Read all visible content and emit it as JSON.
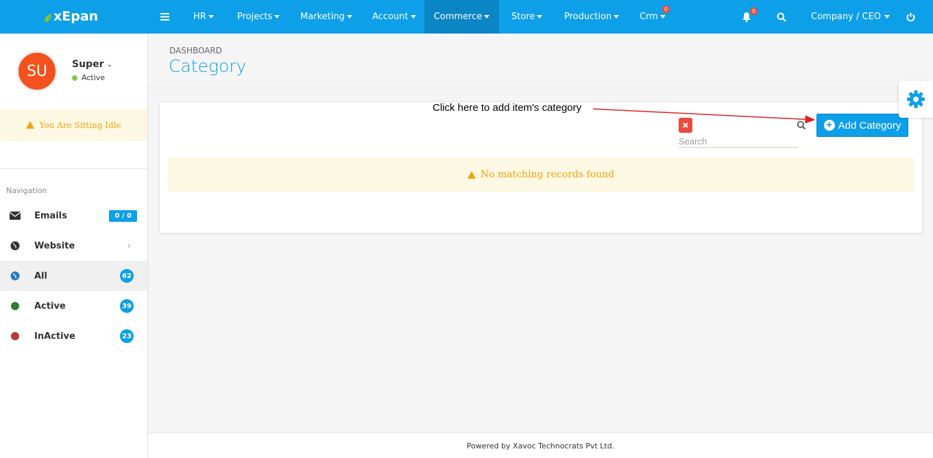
{
  "brand": {
    "logo_text": "xEpan"
  },
  "topnav": {
    "menu": [
      {
        "label": "HR"
      },
      {
        "label": "Projects"
      },
      {
        "label": "Marketing"
      },
      {
        "label": "Account"
      },
      {
        "label": "Commerce"
      },
      {
        "label": "Store"
      },
      {
        "label": "Production"
      },
      {
        "label": "Crm",
        "badge": "0"
      }
    ],
    "active_menu": "Commerce",
    "notifications_badge": "0",
    "user_menu": "Company / CEO"
  },
  "user": {
    "initials": "SU",
    "name": "Super",
    "status": "Active",
    "status_color": "#8bc34a",
    "idle_message": "You Are Sitting Idle"
  },
  "sidebar": {
    "heading": "Navigation",
    "items": [
      {
        "label": "Emails",
        "count": "0 / 0"
      },
      {
        "label": "Website"
      },
      {
        "label": "All",
        "count": "62"
      },
      {
        "label": "Active",
        "count": "39"
      },
      {
        "label": "InActive",
        "count": "23"
      }
    ]
  },
  "page": {
    "breadcrumb": "DASHBOARD",
    "title": "Category",
    "annotation": "Click here to add item's category",
    "search_placeholder": "Search",
    "add_button": "Add Category",
    "empty_message": "No matching records found"
  },
  "footer": {
    "text": "Powered by Xavoc Technocrats Pvt Ltd."
  },
  "colors": {
    "accent": "#0d9fe8",
    "warning": "#f0a30a",
    "danger": "#e74c3c"
  }
}
